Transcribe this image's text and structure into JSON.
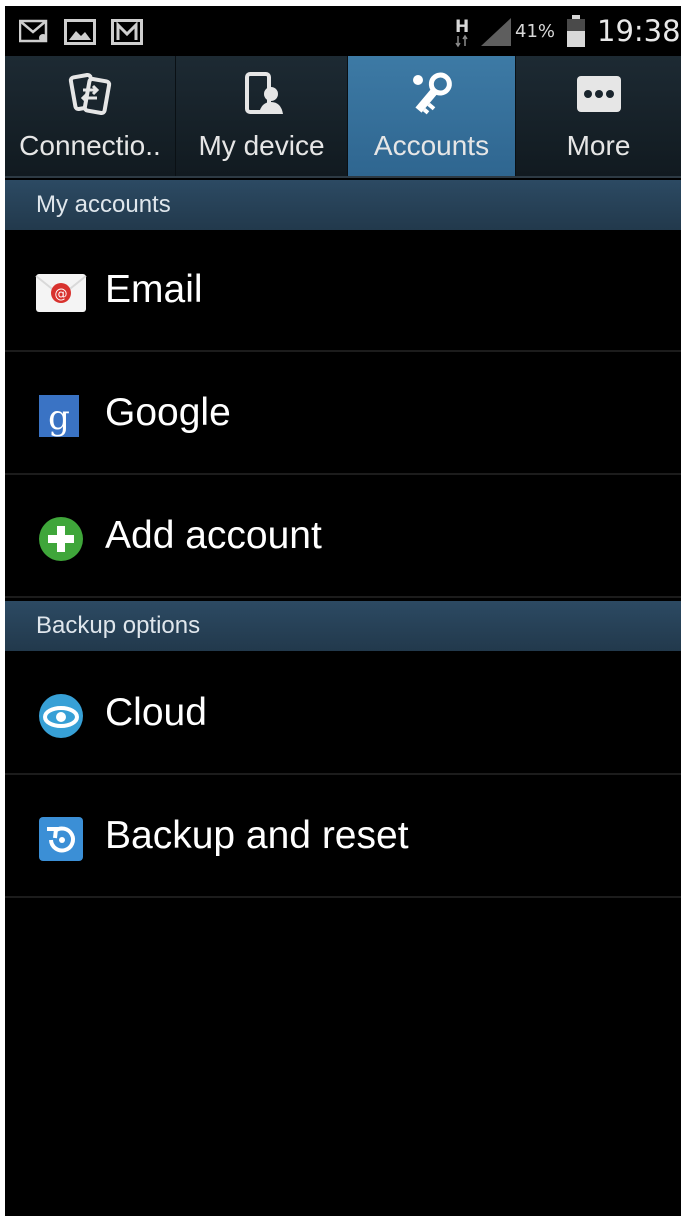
{
  "status_bar": {
    "icons": [
      "email-notification-icon",
      "gallery-notification-icon",
      "gmail-notification-icon"
    ],
    "network": "H",
    "battery": "41%",
    "time": "19:38"
  },
  "tabs": [
    {
      "label": "Connectio..",
      "icon": "connections-icon",
      "active": false
    },
    {
      "label": "My device",
      "icon": "my-device-icon",
      "active": false
    },
    {
      "label": "Accounts",
      "icon": "accounts-key-icon",
      "active": true
    },
    {
      "label": "More",
      "icon": "more-dots-icon",
      "active": false
    }
  ],
  "sections": {
    "my_accounts": {
      "title": "My accounts",
      "items": [
        {
          "label": "Email",
          "icon": "email-icon"
        },
        {
          "label": "Google",
          "icon": "google-icon"
        },
        {
          "label": "Add account",
          "icon": "add-icon"
        }
      ]
    },
    "backup_options": {
      "title": "Backup options",
      "items": [
        {
          "label": "Cloud",
          "icon": "cloud-icon"
        },
        {
          "label": "Backup and reset",
          "icon": "backup-reset-icon"
        }
      ]
    }
  },
  "colors": {
    "active_tab": "#3d7aa5",
    "section_header": "#2c4a63",
    "background": "#000000"
  }
}
